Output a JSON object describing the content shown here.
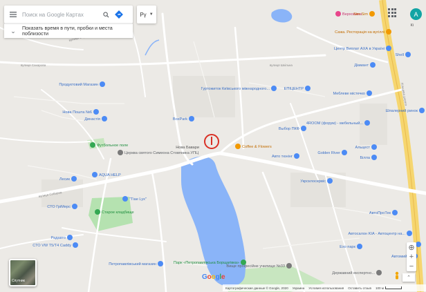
{
  "search": {
    "placeholder": "Поиск на Google Картах"
  },
  "traffic_toggle": {
    "label": "Показать время в пути, пробки и места поблизости"
  },
  "language": {
    "label": "Рү"
  },
  "account": {
    "initial": "A"
  },
  "satellite_toggle": {
    "label": "Спутник"
  },
  "footer": {
    "copyright": "Картографические данные © Google, 2020",
    "region": "Украина",
    "terms": "Условия использования",
    "feedback": "Оставить отзыв",
    "scale": "100 м"
  },
  "colors": {
    "water": "#8ab4f8",
    "road": "#ffffff",
    "highway": "#f6d66f",
    "park": "#b5e2b0",
    "land": "#eceae6",
    "poi_blue": "#4c8bf5",
    "poi_green": "#34a853",
    "poi_orange": "#f29900",
    "poi_pink": "#e8458b",
    "marker": "#d93025"
  },
  "places": [
    {
      "name": "Верховина",
      "color": "pink",
      "icon": "shopping-icon"
    },
    {
      "name": "Sim Sim",
      "color": "orange",
      "icon": "restaurant-icon"
    },
    {
      "name": "Кі",
      "color": "text",
      "icon": ""
    },
    {
      "name": "Сажа. Ресторація на вугіллі",
      "color": "orange",
      "icon": "restaurant-icon"
    },
    {
      "name": "Центр Виплат АХА в Україні",
      "color": "blue",
      "icon": "business-icon"
    },
    {
      "name": "Shell",
      "color": "blue",
      "icon": "gas-icon"
    },
    {
      "name": "Діамант",
      "color": "blue",
      "icon": "business-icon"
    },
    {
      "name": "Продуктовий Магазин",
      "color": "blue",
      "icon": "shopping-icon"
    },
    {
      "name": "Гуртожиток Київського міжнародного...",
      "color": "blue",
      "icon": "building-icon"
    },
    {
      "name": "ЕПІЦЕНТР",
      "color": "blue",
      "icon": "shopping-icon"
    },
    {
      "name": "Меблеве містечко",
      "color": "blue",
      "icon": "shopping-icon"
    },
    {
      "name": "Нова Пошта №6",
      "color": "blue",
      "icon": "post-icon"
    },
    {
      "name": "Династія",
      "color": "blue",
      "icon": "business-icon"
    },
    {
      "name": "Шпалерний ринок",
      "color": "blue",
      "icon": "shopping-icon"
    },
    {
      "name": "4ROOM (форум) - мебельный...",
      "color": "blue",
      "icon": "shopping-icon"
    },
    {
      "name": "Выбор ПКФ",
      "color": "blue",
      "icon": "business-icon"
    },
    {
      "name": "BoxPark",
      "color": "blue",
      "icon": "business-icon"
    },
    {
      "name": "Футбольное поле",
      "color": "green",
      "icon": "park-icon"
    },
    {
      "name": "Церква святого Симеона Стовпника УПЦ",
      "color": "gray",
      "icon": "church-icon"
    },
    {
      "name": "Нова Бавари",
      "color": "text",
      "icon": ""
    },
    {
      "name": "Coffee & Flowers",
      "color": "orange",
      "icon": "cafe-icon"
    },
    {
      "name": "Авто тюнінг",
      "color": "blue",
      "icon": "car-icon"
    },
    {
      "name": "Golden River",
      "color": "blue",
      "icon": "business-icon"
    },
    {
      "name": "Альцест",
      "color": "blue",
      "icon": "business-icon"
    },
    {
      "name": "Білла",
      "color": "blue",
      "icon": "shopping-icon"
    },
    {
      "name": "Лесик",
      "color": "blue",
      "icon": "business-icon"
    },
    {
      "name": "AQUA HELP",
      "color": "blue",
      "icon": "business-icon"
    },
    {
      "name": "Укрсклосервіс",
      "color": "blue",
      "icon": "business-icon"
    },
    {
      "name": "СТО ГрiМерс",
      "color": "blue",
      "icon": "car-icon"
    },
    {
      "name": "\"Тiaе Lyx\"",
      "color": "blue",
      "icon": "business-icon"
    },
    {
      "name": "Старое кладбище",
      "color": "green",
      "icon": "cemetery-icon"
    },
    {
      "name": "АвтоПроТек",
      "color": "blue",
      "icon": "car-icon"
    },
    {
      "name": "Автосалон KIA - Автоцентр на...",
      "color": "blue",
      "icon": "car-icon"
    },
    {
      "name": "Радавто",
      "color": "blue",
      "icon": "car-icon"
    },
    {
      "name": "СТО VW T5/T4 Caddy",
      "color": "blue",
      "icon": "car-icon"
    },
    {
      "name": "Exo парк",
      "color": "blue",
      "icon": "business-icon"
    },
    {
      "name": "КЛО",
      "color": "blue",
      "icon": "gas-icon"
    },
    {
      "name": "Автомийка",
      "color": "blue",
      "icon": "car-icon"
    },
    {
      "name": "Парк «Петропавлівська Борщагівка»",
      "color": "green",
      "icon": "park-icon"
    },
    {
      "name": "Вище професійне училище №33",
      "color": "gray",
      "icon": "school-icon"
    },
    {
      "name": "Державний експертно...",
      "color": "gray",
      "icon": "building-icon"
    },
    {
      "name": "Петропавлівський магазин",
      "color": "blue",
      "icon": "shopping-icon"
    }
  ],
  "streets": [
    "вулиця Сєрова",
    "вулиця Сахарова",
    "вулиця Шкільна",
    "вулиця Соборна",
    "Кільцева дорога"
  ]
}
